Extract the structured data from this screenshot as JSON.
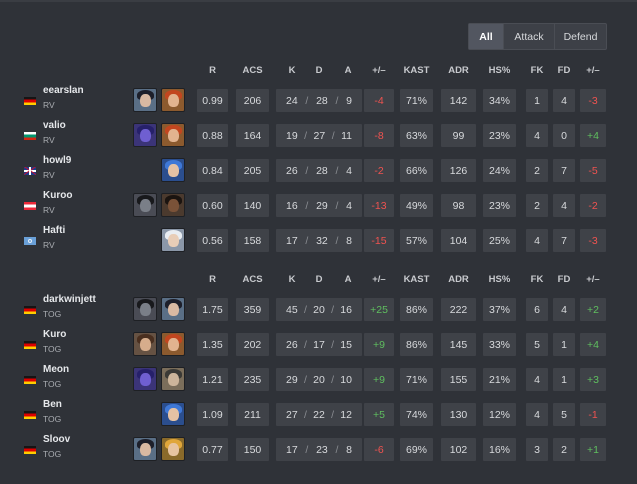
{
  "filter": {
    "tabs": [
      "All",
      "Attack",
      "Defend"
    ],
    "active": "All"
  },
  "headers": {
    "r": "R",
    "acs": "ACS",
    "k": "K",
    "d": "D",
    "a": "A",
    "pm": "+/–",
    "kast": "KAST",
    "adr": "ADR",
    "hs": "HS%",
    "fk": "FK",
    "fd": "FD",
    "pm2": "+/–"
  },
  "teams": [
    {
      "players": [
        {
          "name": "eearslan",
          "team": "RV",
          "flag": "de",
          "agents": [
            "agent-dark-hair",
            "agent-red-hair"
          ],
          "r": "0.99",
          "acs": "206",
          "k": "24",
          "d": "28",
          "a": "9",
          "pm": "-4",
          "kast": "71%",
          "adr": "142",
          "hs": "34%",
          "fk": "1",
          "fd": "4",
          "pm2": "-3"
        },
        {
          "name": "valio",
          "team": "RV",
          "flag": "bg",
          "agents": [
            "agent-purple-hood",
            "agent-red-hair"
          ],
          "r": "0.88",
          "acs": "164",
          "k": "19",
          "d": "27",
          "a": "11",
          "pm": "-8",
          "kast": "63%",
          "adr": "99",
          "hs": "23%",
          "fk": "4",
          "fd": "0",
          "pm2": "+4"
        },
        {
          "name": "howl9",
          "team": "RV",
          "flag": "gb",
          "agents": [
            "agent-blue-hair"
          ],
          "r": "0.84",
          "acs": "205",
          "k": "26",
          "d": "28",
          "a": "4",
          "pm": "-2",
          "kast": "66%",
          "adr": "126",
          "hs": "24%",
          "fk": "2",
          "fd": "7",
          "pm2": "-5"
        },
        {
          "name": "Kuroo",
          "team": "RV",
          "flag": "at",
          "agents": [
            "agent-masked",
            "agent-dark-skin"
          ],
          "r": "0.60",
          "acs": "140",
          "k": "16",
          "d": "29",
          "a": "4",
          "pm": "-13",
          "kast": "49%",
          "adr": "98",
          "hs": "23%",
          "fk": "2",
          "fd": "4",
          "pm2": "-2"
        },
        {
          "name": "Hafti",
          "team": "RV",
          "flag": "un",
          "agents": [
            "agent-white-hair"
          ],
          "r": "0.56",
          "acs": "158",
          "k": "17",
          "d": "32",
          "a": "8",
          "pm": "-15",
          "kast": "57%",
          "adr": "104",
          "hs": "25%",
          "fk": "4",
          "fd": "7",
          "pm2": "-3"
        }
      ]
    },
    {
      "players": [
        {
          "name": "darkwinjett",
          "team": "TOG",
          "flag": "de",
          "agents": [
            "agent-masked",
            "agent-dark-hair"
          ],
          "r": "1.75",
          "acs": "359",
          "k": "45",
          "d": "20",
          "a": "16",
          "pm": "+25",
          "kast": "86%",
          "adr": "222",
          "hs": "37%",
          "fk": "6",
          "fd": "4",
          "pm2": "+2"
        },
        {
          "name": "Kuro",
          "team": "TOG",
          "flag": "de",
          "agents": [
            "agent-brown-hair",
            "agent-red-hair"
          ],
          "r": "1.35",
          "acs": "202",
          "k": "26",
          "d": "17",
          "a": "15",
          "pm": "+9",
          "kast": "86%",
          "adr": "145",
          "hs": "33%",
          "fk": "5",
          "fd": "1",
          "pm2": "+4"
        },
        {
          "name": "Meon",
          "team": "TOG",
          "flag": "de",
          "agents": [
            "agent-purple-hood",
            "agent-hat"
          ],
          "r": "1.21",
          "acs": "235",
          "k": "29",
          "d": "20",
          "a": "10",
          "pm": "+9",
          "kast": "71%",
          "adr": "155",
          "hs": "21%",
          "fk": "4",
          "fd": "1",
          "pm2": "+3"
        },
        {
          "name": "Ben",
          "team": "TOG",
          "flag": "de",
          "agents": [
            "agent-blue-hair"
          ],
          "r": "1.09",
          "acs": "211",
          "k": "27",
          "d": "22",
          "a": "12",
          "pm": "+5",
          "kast": "74%",
          "adr": "130",
          "hs": "12%",
          "fk": "4",
          "fd": "5",
          "pm2": "-1"
        },
        {
          "name": "Sloov",
          "team": "TOG",
          "flag": "de",
          "agents": [
            "agent-dark-hair",
            "agent-gold-hair"
          ],
          "r": "0.77",
          "acs": "150",
          "k": "17",
          "d": "23",
          "a": "8",
          "pm": "-6",
          "kast": "69%",
          "adr": "102",
          "hs": "16%",
          "fk": "3",
          "fd": "2",
          "pm2": "+1"
        }
      ]
    }
  ],
  "colors": {
    "positive": "#5fbf5f",
    "negative": "#ef5350",
    "cell_bg": "#3f4248",
    "page_bg": "#2f3238"
  }
}
